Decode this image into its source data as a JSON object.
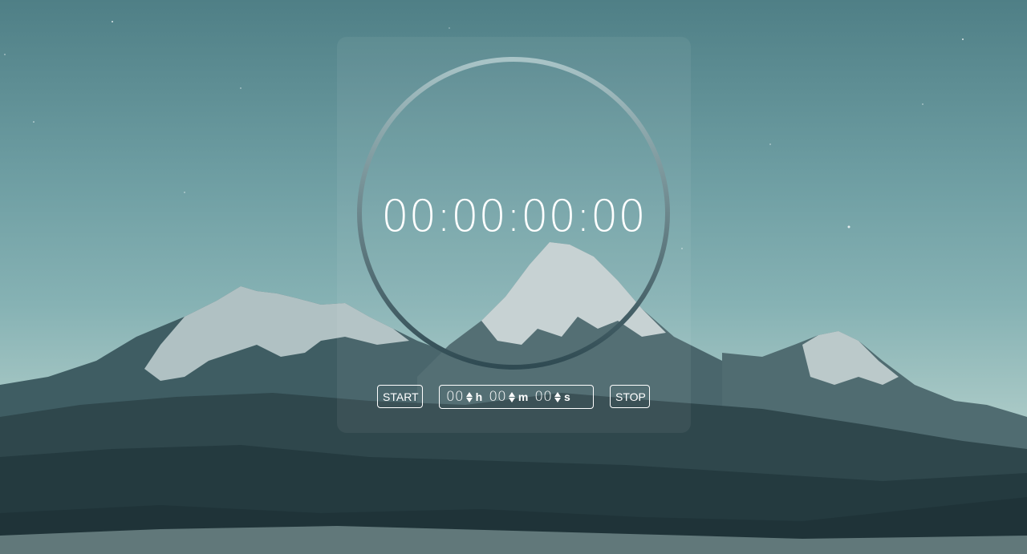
{
  "timer": {
    "display": "00:00:00:00"
  },
  "controls": {
    "start_label": "START",
    "stop_label": "STOP"
  },
  "duration": {
    "hours": {
      "value": "00",
      "unit": "h"
    },
    "minutes": {
      "value": "00",
      "unit": "m"
    },
    "seconds": {
      "value": "00",
      "unit": "s"
    }
  },
  "colors": {
    "text": "#ffffff",
    "ring_top": "#a9c4c7",
    "ring_bottom": "#2f4a52",
    "sky_top": "#4f7f86",
    "sky_bottom": "#c8ddd6"
  },
  "background": {
    "scene": "snowy-mountain-range-at-dusk"
  }
}
